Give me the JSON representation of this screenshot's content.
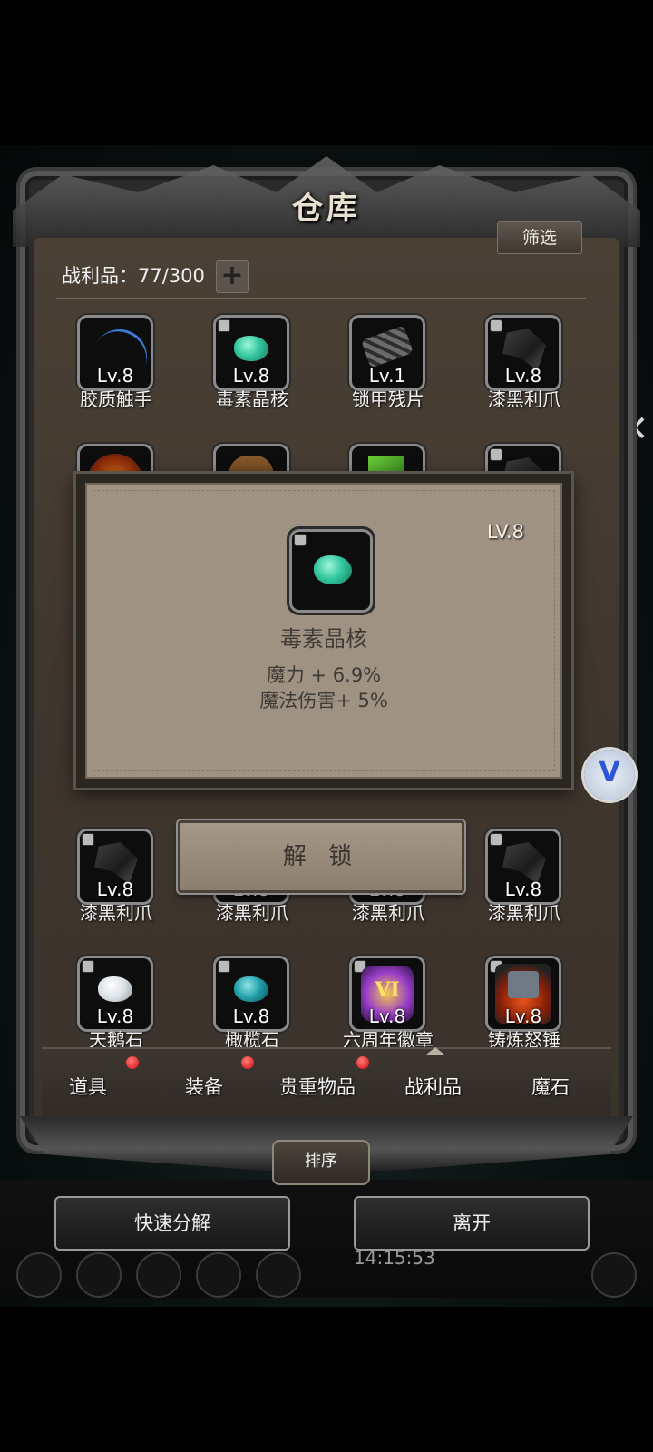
{
  "window": {
    "title": "仓库"
  },
  "header": {
    "filter_label": "筛选",
    "loot_label": "战利品：77/300",
    "add_label": "+"
  },
  "grid": {
    "row1": [
      {
        "level": "Lv.8",
        "name": "胶质触手",
        "icon": "tentacle-icon"
      },
      {
        "level": "Lv.8",
        "name": "毒素晶核",
        "icon": "green-gem-icon"
      },
      {
        "level": "Lv.1",
        "name": "锁甲残片",
        "icon": "chain-mail-icon"
      },
      {
        "level": "Lv.8",
        "name": "漆黑利爪",
        "icon": "black-claw-icon"
      }
    ],
    "row4": [
      {
        "level": "Lv.8",
        "name": "漆黑利爪",
        "icon": "black-claw-icon"
      },
      {
        "level": "Lv.8",
        "name": "漆黑利爪",
        "icon": "black-claw-icon"
      },
      {
        "level": "Lv.8",
        "name": "漆黑利爪",
        "icon": "black-claw-icon"
      },
      {
        "level": "Lv.8",
        "name": "漆黑利爪",
        "icon": "black-claw-icon"
      }
    ],
    "row5": [
      {
        "level": "Lv.8",
        "name": "天鹅石",
        "icon": "white-stone-icon"
      },
      {
        "level": "Lv.8",
        "name": "橄榄石",
        "icon": "teal-stone-icon"
      },
      {
        "level": "Lv.8",
        "name": "六周年徽章",
        "icon": "anniversary-badge-icon",
        "badge_text": "VI"
      },
      {
        "level": "Lv.8",
        "name": "铸炼怒锤",
        "icon": "forge-hammer-icon"
      }
    ]
  },
  "popup": {
    "level": "LV.8",
    "name": "毒素晶核",
    "stats": [
      "魔力 + 6.9%",
      "魔法伤害+ 5%"
    ],
    "unlock_label": "解 锁"
  },
  "tabs": [
    {
      "label": "道具",
      "badge": true
    },
    {
      "label": "装备",
      "badge": true
    },
    {
      "label": "贵重物品",
      "badge": true
    },
    {
      "label": "战利品",
      "badge": false,
      "active": true
    },
    {
      "label": "魔石",
      "badge": false
    }
  ],
  "footer": {
    "sort_label": "排序",
    "quick_decompose_label": "快速分解",
    "leave_label": "离开",
    "clock": "14:15:53"
  },
  "floating": {
    "v_label": "V",
    "close_label": "✕"
  },
  "colors": {
    "red_dot": "#d40a0a",
    "gem_green": "#34c8a0",
    "panel_parchment": "#a09282"
  }
}
